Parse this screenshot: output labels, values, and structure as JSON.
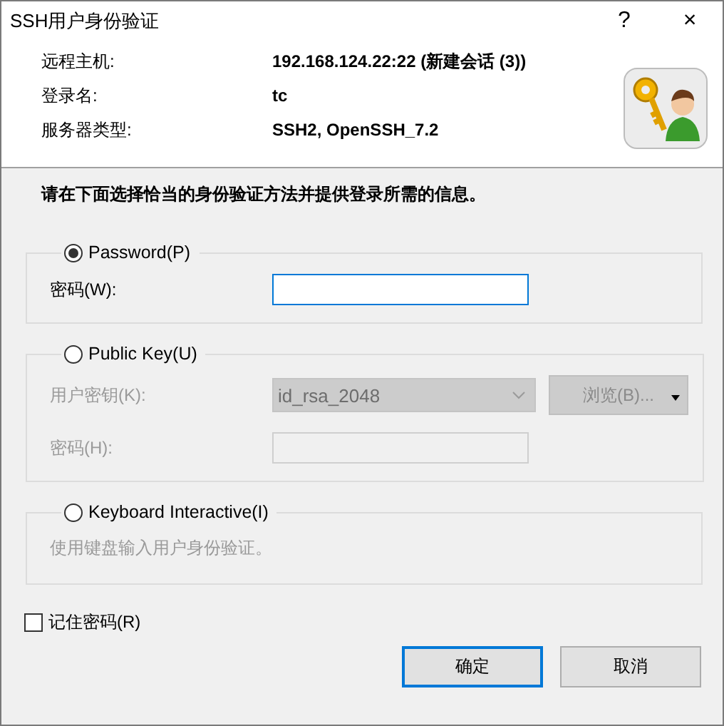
{
  "window": {
    "title": "SSH用户身份验证",
    "help": "?",
    "close": "×"
  },
  "info": [
    {
      "label": "远程主机:",
      "value": "192.168.124.22:22 (新建会话 (3))"
    },
    {
      "label": "登录名:",
      "value": "tc"
    },
    {
      "label": "服务器类型:",
      "value": "SSH2, OpenSSH_7.2"
    }
  ],
  "instruction": "请在下面选择恰当的身份验证方法并提供登录所需的信息。",
  "methods": [
    {
      "label": "Password(P)",
      "selected": true,
      "disabled": false,
      "fields": [
        {
          "kind": "text",
          "label": "密码(W):",
          "focused": true
        }
      ]
    },
    {
      "label": "Public Key(U)",
      "selected": false,
      "disabled": true,
      "fields": [
        {
          "kind": "dropdown",
          "label": "用户密钥(K):",
          "value": "id_rsa_2048",
          "button": "浏览(B)..."
        },
        {
          "kind": "text",
          "label": "密码(H):",
          "focused": false
        }
      ]
    },
    {
      "label": "Keyboard Interactive(I)",
      "selected": false,
      "disabled": true,
      "description": "使用键盘输入用户身份验证。"
    }
  ],
  "remember": {
    "label": "记住密码(R)",
    "checked": false
  },
  "buttons": [
    {
      "label": "确定",
      "default": true
    },
    {
      "label": "取消",
      "default": false
    }
  ]
}
